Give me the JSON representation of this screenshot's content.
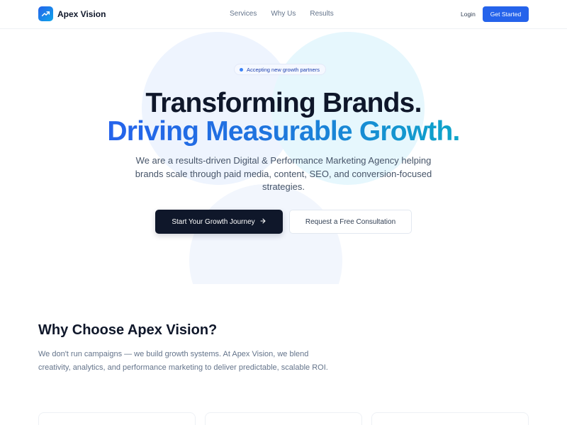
{
  "nav": {
    "brand": "Apex Vision",
    "links": [
      "Services",
      "Why Us",
      "Results"
    ],
    "login": "Login",
    "cta": "Get Started"
  },
  "hero": {
    "badge": "Accepting new growth partners",
    "title_line1": "Transforming Brands.",
    "title_line2": "Driving Measurable Growth.",
    "subtitle": "We are a results-driven Digital & Performance Marketing Agency helping brands scale through paid media, content, SEO, and conversion-focused strategies.",
    "primary_button": "Start Your Growth Journey",
    "secondary_button": "Request a Free Consultation"
  },
  "why": {
    "title": "Why Choose Apex Vision?",
    "text": "We don't run campaigns — we build growth systems. At Apex Vision, we blend creativity, analytics, and performance marketing to deliver predictable, scalable ROI."
  },
  "colors": {
    "accent": "#2563eb",
    "dark": "#0f172a",
    "gradient_end": "#0ea5c9"
  },
  "icons": {
    "logo": "trending-up-icon",
    "badge": "dot-icon",
    "primary_button": "arrow-right-icon"
  }
}
